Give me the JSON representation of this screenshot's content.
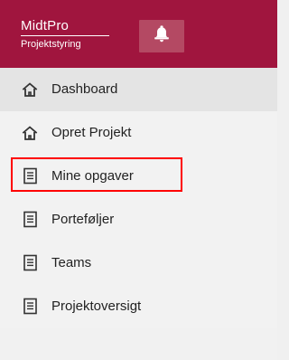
{
  "header": {
    "brand_title": "MidtPro",
    "brand_subtitle": "Projektstyring",
    "background_color": "#a0153e",
    "notification_button_color": "#b44963",
    "notification_icon": "bell-icon"
  },
  "nav": {
    "items": [
      {
        "label": "Dashboard",
        "icon": "home-icon",
        "active": true
      },
      {
        "label": "Opret Projekt",
        "icon": "home-icon",
        "active": false
      },
      {
        "label": "Mine opgaver",
        "icon": "document-icon",
        "active": false,
        "highlighted": true
      },
      {
        "label": "Porteføljer",
        "icon": "document-icon",
        "active": false
      },
      {
        "label": "Teams",
        "icon": "document-icon",
        "active": false
      },
      {
        "label": "Projektoversigt",
        "icon": "document-icon",
        "active": false
      }
    ],
    "highlight_color": "#ff0000"
  }
}
